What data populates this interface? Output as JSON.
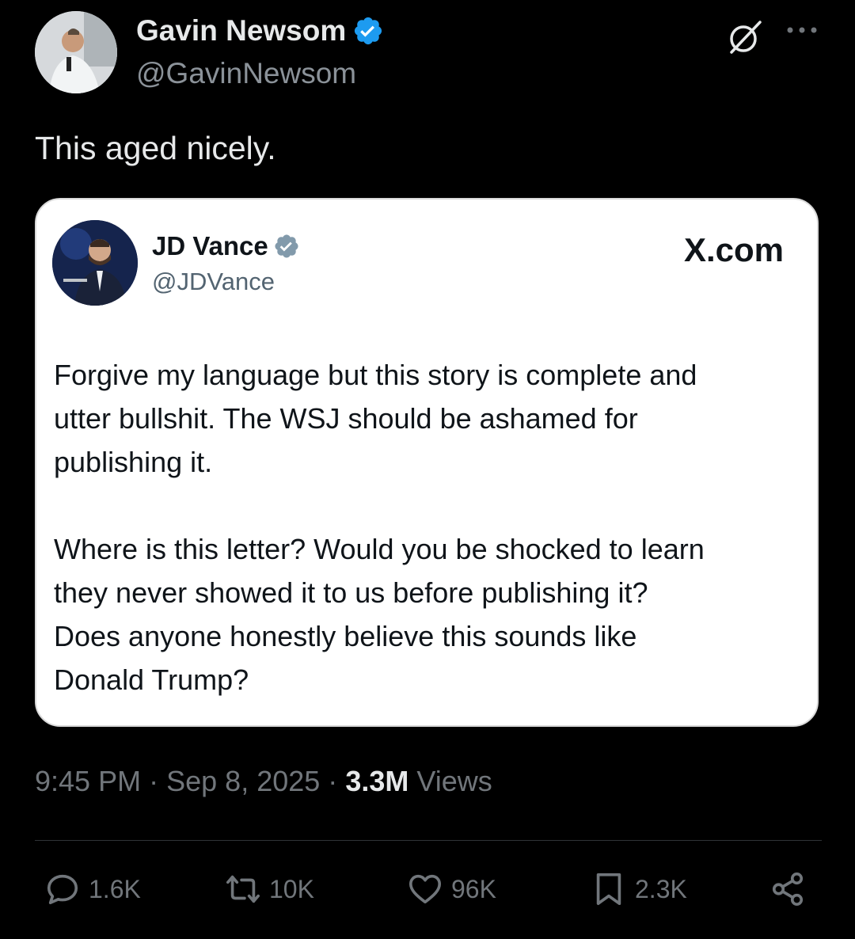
{
  "author": {
    "name": "Gavin Newsom",
    "handle": "@GavinNewsom",
    "verified_color": "#1d9bf0"
  },
  "tweet": {
    "text": "This aged nicely."
  },
  "quote": {
    "name": "JD Vance",
    "handle": "@JDVance",
    "brand": "X.com",
    "verified_color": "#829aab",
    "paragraphs": [
      "Forgive my language but this story is complete and\nutter bullshit. The WSJ should be ashamed for\npublishing it.",
      "Where is this letter? Would you be shocked to learn\nthey never showed it to us before publishing it?\nDoes anyone honestly believe this sounds like\nDonald Trump?"
    ]
  },
  "meta": {
    "time": "9:45 PM",
    "sep1": "·",
    "date": "Sep 8, 2025",
    "sep2": "·",
    "views_count": "3.3M",
    "views_label": "Views"
  },
  "actions": {
    "replies": "1.6K",
    "reposts": "10K",
    "likes": "96K",
    "bookmarks": "2.3K"
  },
  "icons": [
    "grok-icon",
    "more-icon",
    "verified-icon",
    "reply-icon",
    "repost-icon",
    "like-icon",
    "bookmark-icon",
    "share-icon"
  ]
}
